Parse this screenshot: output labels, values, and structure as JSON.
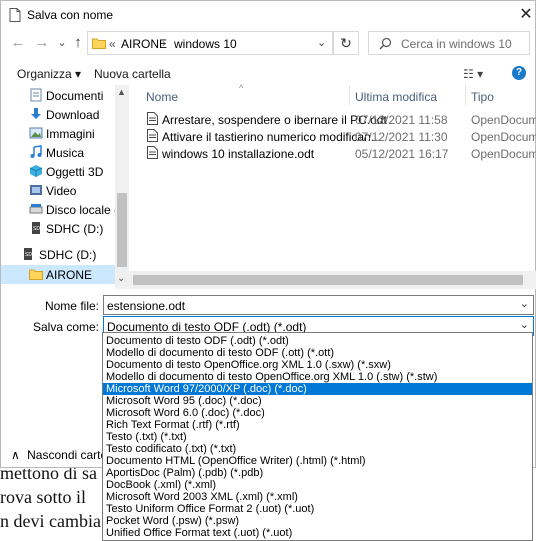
{
  "window": {
    "title": "Salva con nome",
    "close_glyph": "✕"
  },
  "background_text": [
    "mettono di sa",
    "rova sotto il",
    "n devi cambia"
  ],
  "nav": {
    "back_glyph": "←",
    "forward_glyph": "→",
    "dropdown_glyph": "⌄",
    "up_glyph": "↑",
    "breadcrumb": {
      "prefix": "«",
      "items": [
        "AIRONE",
        "windows 10"
      ],
      "separator": "›"
    },
    "refresh_glyph": "↻",
    "search_placeholder": "Cerca in windows 10"
  },
  "toolbar": {
    "organize_label": "Organizza ▾",
    "new_folder_label": "Nuova cartella",
    "view_glyph": "☷ ▾",
    "help_glyph": "?"
  },
  "sidebar": {
    "items": [
      {
        "label": "Documenti",
        "icon": "documents-icon"
      },
      {
        "label": "Download",
        "icon": "download-icon"
      },
      {
        "label": "Immagini",
        "icon": "pictures-icon"
      },
      {
        "label": "Musica",
        "icon": "music-icon"
      },
      {
        "label": "Oggetti 3D",
        "icon": "3d-objects-icon"
      },
      {
        "label": "Video",
        "icon": "video-icon"
      },
      {
        "label": "Disco locale (C:)",
        "icon": "drive-icon"
      },
      {
        "label": "SDHC (D:)",
        "icon": "sd-card-icon"
      },
      {
        "label": "SDHC (D:)",
        "icon": "sd-card-icon"
      },
      {
        "label": "AIRONE",
        "icon": "folder-icon"
      }
    ]
  },
  "file_list": {
    "columns": [
      "Nome",
      "Ultima modifica",
      "Tipo"
    ],
    "rows": [
      {
        "name": "Arrestare, sospendere o ibernare il PC.odt",
        "date": "07/12/2021 11:58",
        "type": "OpenDocument"
      },
      {
        "name": "Attivare il tastierino numerico modifican...",
        "date": "07/12/2021 11:30",
        "type": "OpenDocument"
      },
      {
        "name": "windows 10 installazione.odt",
        "date": "05/12/2021 16:17",
        "type": "OpenDocument"
      }
    ]
  },
  "form": {
    "filename_label": "Nome file:",
    "filename_value": "estensione.odt",
    "savetype_label": "Salva come:",
    "savetype_value": "Documento di testo ODF (.odt) (*.odt)"
  },
  "savetype_options": [
    "Documento di testo ODF (.odt) (*.odt)",
    "Modello di documento di testo ODF (.ott) (*.ott)",
    "Documento di testo OpenOffice.org XML 1.0 (.sxw) (*.sxw)",
    "Modello di documento di testo OpenOffice.org XML 1.0 (.stw) (*.stw)",
    "Microsoft Word 97/2000/XP (.doc) (*.doc)",
    "Microsoft Word 95 (.doc) (*.doc)",
    "Microsoft Word 6.0 (.doc) (*.doc)",
    "Rich Text Format (.rtf) (*.rtf)",
    "Testo (.txt) (*.txt)",
    "Testo codificato (.txt) (*.txt)",
    "Documento HTML (OpenOffice Writer) (.html) (*.html)",
    "AportisDoc (Palm) (.pdb) (*.pdb)",
    "DocBook (.xml) (*.xml)",
    "Microsoft Word 2003 XML (.xml) (*.xml)",
    "Testo Uniform Office Format 2 (.uot) (*.uot)",
    "Pocket Word (.psw) (*.psw)",
    "Unified Office Format text (.uot) (*.uot)"
  ],
  "selected_option_index": 4,
  "footer": {
    "hide_folders_label": "Nascondi cartelle",
    "hide_glyph": "∧"
  },
  "colors": {
    "accent": "#0078d7",
    "selection": "#cce8ff"
  }
}
